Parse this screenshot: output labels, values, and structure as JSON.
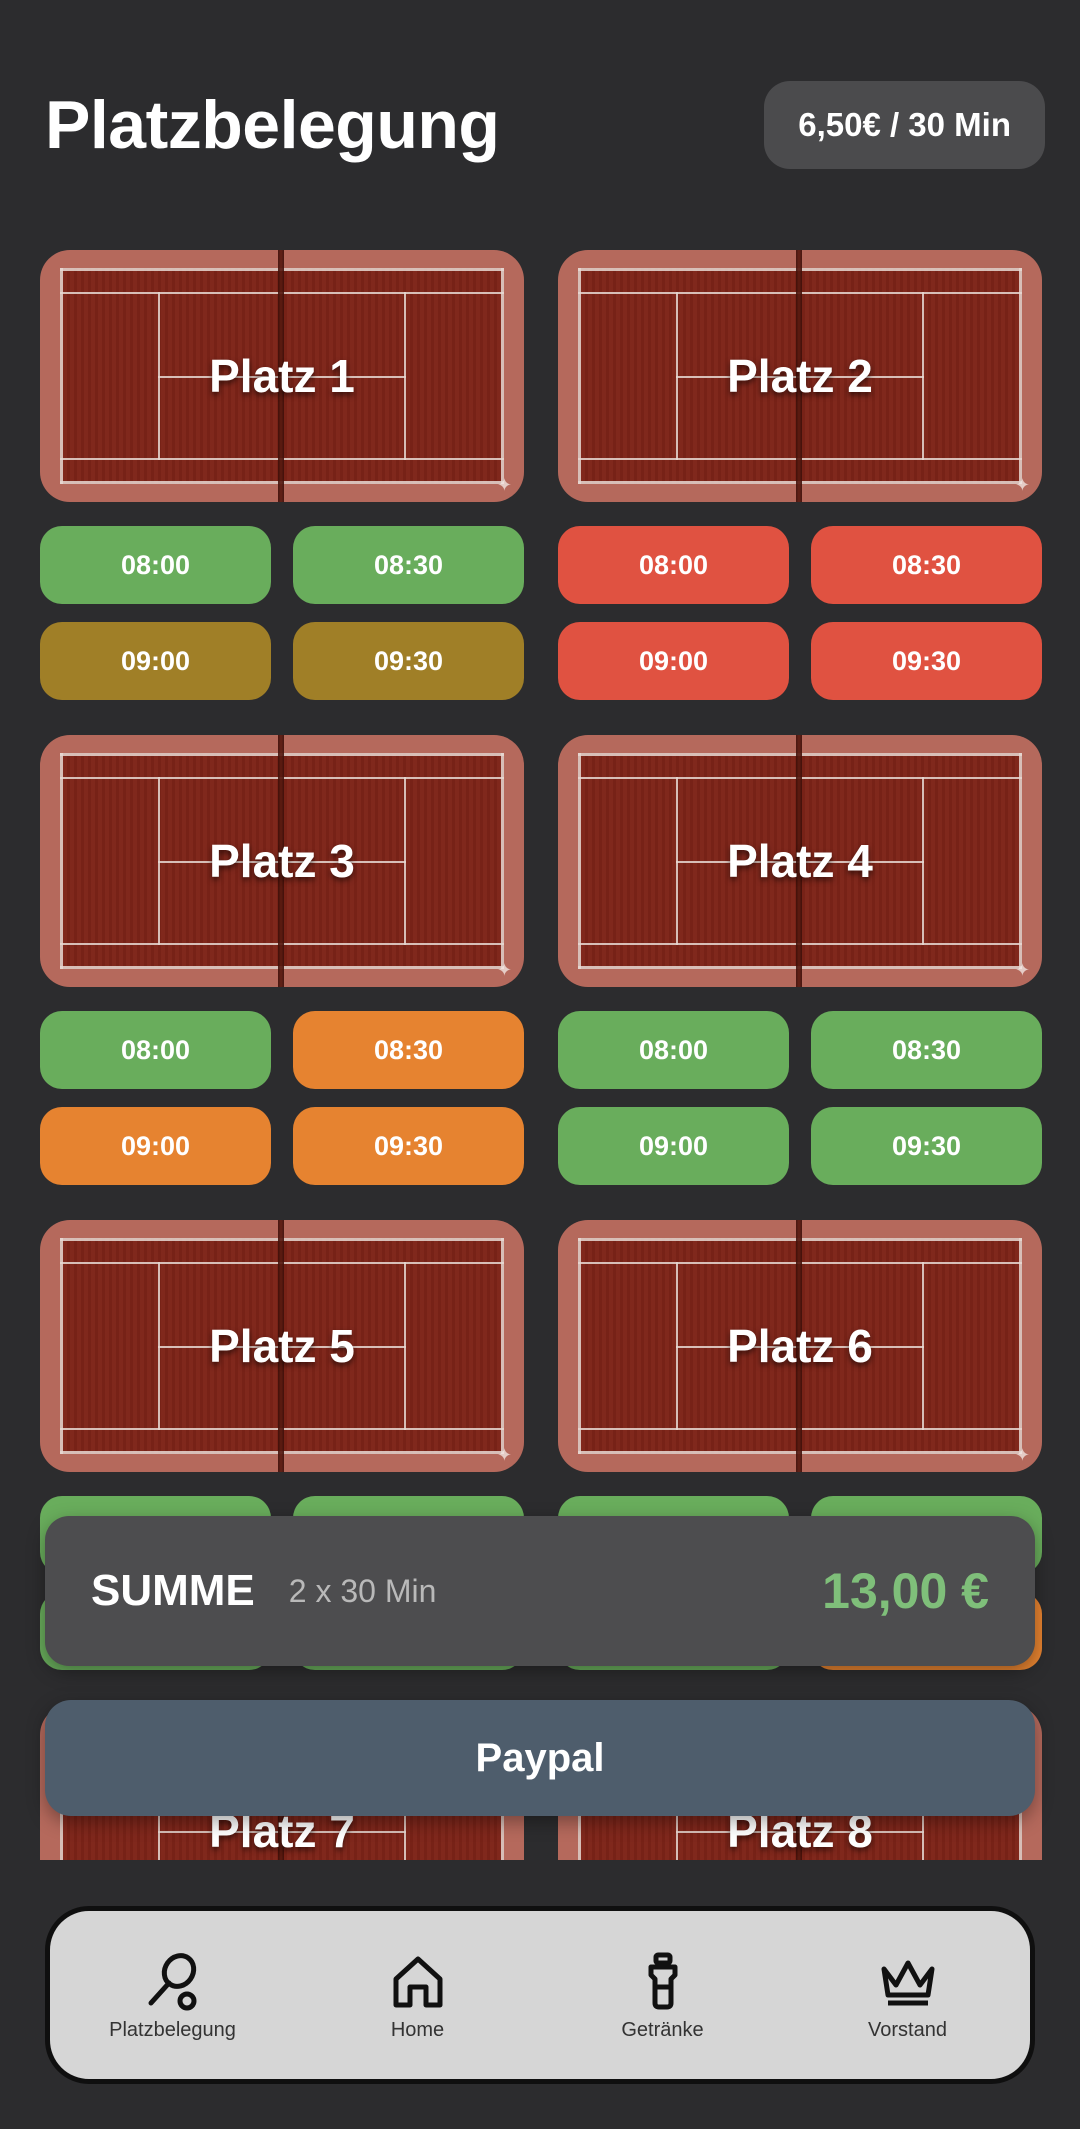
{
  "header": {
    "title": "Platzbelegung",
    "price": "6,50€ / 30 Min"
  },
  "colors": {
    "free": "#69ad5c",
    "booked": "#e05241",
    "pending": "#a07f27",
    "selected": "#e68330"
  },
  "courts": [
    {
      "label": "Platz 1",
      "slots": [
        {
          "time": "08:00",
          "status": "free"
        },
        {
          "time": "08:30",
          "status": "free"
        },
        {
          "time": "09:00",
          "status": "pending"
        },
        {
          "time": "09:30",
          "status": "pending"
        }
      ]
    },
    {
      "label": "Platz 2",
      "slots": [
        {
          "time": "08:00",
          "status": "booked"
        },
        {
          "time": "08:30",
          "status": "booked"
        },
        {
          "time": "09:00",
          "status": "booked"
        },
        {
          "time": "09:30",
          "status": "booked"
        }
      ]
    },
    {
      "label": "Platz 3",
      "slots": [
        {
          "time": "08:00",
          "status": "free"
        },
        {
          "time": "08:30",
          "status": "selected"
        },
        {
          "time": "09:00",
          "status": "selected"
        },
        {
          "time": "09:30",
          "status": "selected"
        }
      ]
    },
    {
      "label": "Platz 4",
      "slots": [
        {
          "time": "08:00",
          "status": "free"
        },
        {
          "time": "08:30",
          "status": "free"
        },
        {
          "time": "09:00",
          "status": "free"
        },
        {
          "time": "09:30",
          "status": "free"
        }
      ]
    },
    {
      "label": "Platz 5",
      "slots": [
        {
          "time": "",
          "status": "free"
        },
        {
          "time": "",
          "status": "free"
        },
        {
          "time": "",
          "status": "free"
        },
        {
          "time": "",
          "status": "free"
        }
      ]
    },
    {
      "label": "Platz 6",
      "slots": [
        {
          "time": "",
          "status": "free"
        },
        {
          "time": "",
          "status": "free"
        },
        {
          "time": "",
          "status": "free"
        },
        {
          "time": "",
          "status": "selected"
        }
      ]
    },
    {
      "label": "Platz 7",
      "slots": []
    },
    {
      "label": "Platz 8",
      "slots": []
    }
  ],
  "summary": {
    "label": "SUMME",
    "detail": "2 x 30 Min",
    "total": "13,00 €"
  },
  "paypal_label": "Paypal",
  "nav": [
    {
      "label": "Platzbelegung",
      "icon": "racket-icon"
    },
    {
      "label": "Home",
      "icon": "home-icon"
    },
    {
      "label": "Getränke",
      "icon": "bottle-icon"
    },
    {
      "label": "Vorstand",
      "icon": "crown-icon"
    }
  ]
}
